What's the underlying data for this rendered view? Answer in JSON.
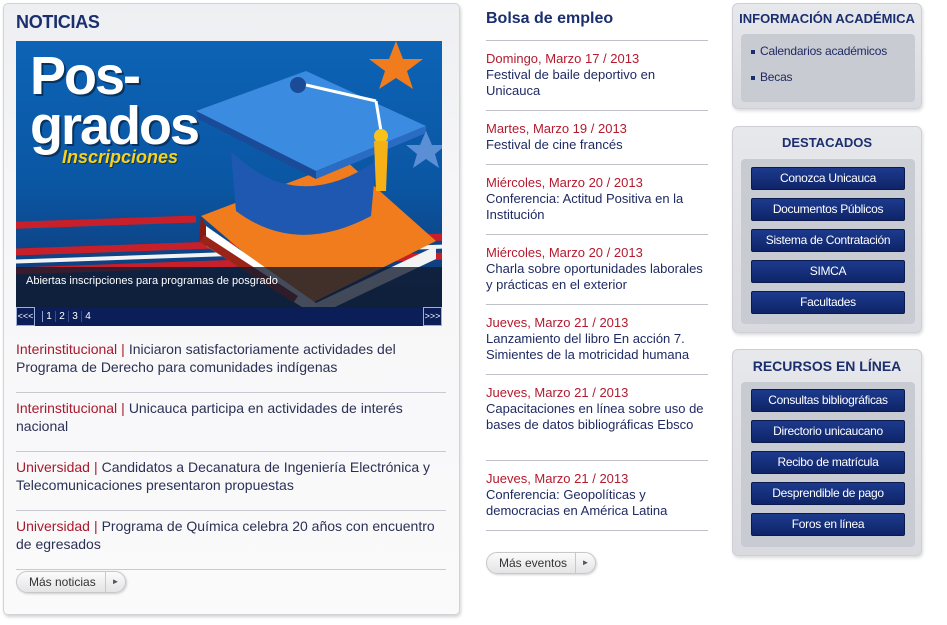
{
  "noticias": {
    "title": "NOTICIAS",
    "banner": {
      "headline_line1": "Pos-",
      "headline_line2": "grados",
      "headline_sub": "Inscripciones",
      "caption": "Abiertas inscripciones para programas de posgrado",
      "prev_label": "<<<",
      "next_label": ">>>",
      "pages": [
        "1",
        "2",
        "3",
        "4"
      ]
    },
    "items": [
      {
        "category": "Interinstitucional",
        "separator": "|",
        "text": "Iniciaron satisfactoriamente actividades del Programa de Derecho para comunidades indígenas"
      },
      {
        "category": "Interinstitucional",
        "separator": "|",
        "text": "Unicauca participa en actividades de interés nacional"
      },
      {
        "category": "Universidad",
        "separator": "|",
        "text": "Candidatos a Decanatura de Ingeniería Electrónica y Telecomunicaciones presentaron propuestas"
      },
      {
        "category": "Universidad",
        "separator": "|",
        "text": "Programa de Química celebra 20 años con encuentro de egresados"
      }
    ],
    "more_button": "Más noticias",
    "arrow_glyph": "►"
  },
  "bolsa": {
    "title": "Bolsa de empleo",
    "events": [
      {
        "date": "Domingo, Marzo 17 / 2013",
        "title": "Festival de baile deportivo en Unicauca"
      },
      {
        "date": "Martes, Marzo 19 / 2013",
        "title": "Festival de cine francés"
      },
      {
        "date": "Miércoles, Marzo 20 / 2013",
        "title": "Conferencia: Actitud Positiva en la Institución"
      },
      {
        "date": "Miércoles, Marzo 20 / 2013",
        "title": "Charla sobre oportunidades laborales y prácticas en el exterior"
      },
      {
        "date": "Jueves, Marzo 21 / 2013",
        "title": "Lanzamiento del libro En acción 7. Simientes de la motricidad humana"
      },
      {
        "date": "Jueves, Marzo 21 / 2013",
        "title": "Capacitaciones en línea sobre uso de bases de datos bibliográficas Ebsco"
      },
      {
        "date": "Jueves, Marzo 21 / 2013",
        "title": "Conferencia: Geopolíticas y democracias en América Latina"
      }
    ],
    "more_button": "Más eventos"
  },
  "informacion": {
    "title": "INFORMACIÓN ACADÉMICA",
    "links": [
      "Calendarios académicos",
      "Becas"
    ]
  },
  "destacados": {
    "title": "DESTACADOS",
    "buttons": [
      "Conozca Unicauca",
      "Documentos Públicos",
      "Sistema de Contratación",
      "SIMCA",
      "Facultades"
    ]
  },
  "recursos": {
    "title": "RECURSOS EN LÍNEA",
    "buttons": [
      "Consultas bibliográficas",
      "Directorio unicaucano",
      "Recibo de matrícula",
      "Desprendible de pago",
      "Foros en línea"
    ]
  },
  "colors": {
    "heading_blue": "#1b2f6e",
    "category_red": "#a8192d",
    "button_blue": "#1c3a8d"
  }
}
